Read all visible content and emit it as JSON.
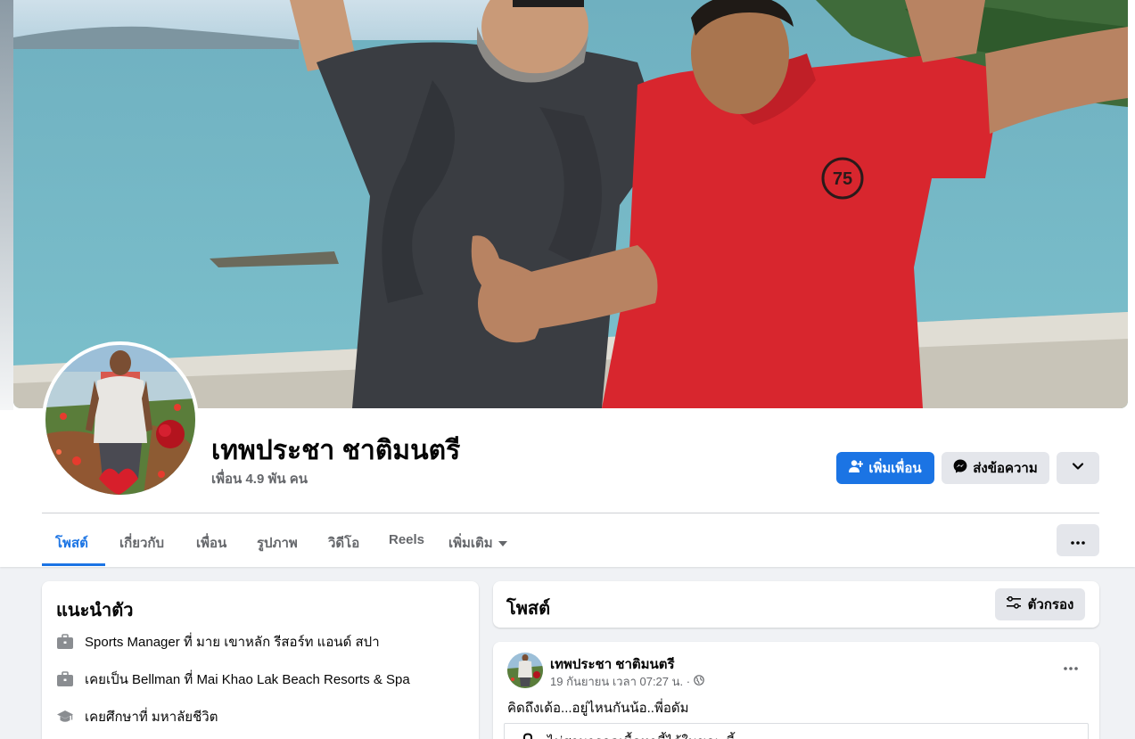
{
  "profile": {
    "name": "เทพประชา ชาติมนตรี",
    "friends": "เพื่อน 4.9 พัน คน"
  },
  "actions": {
    "add_friend": "เพิ่มเพื่อน",
    "message": "ส่งข้อความ"
  },
  "tabs": [
    {
      "label": "โพสต์",
      "active": true
    },
    {
      "label": "เกี่ยวกับ"
    },
    {
      "label": "เพื่อน"
    },
    {
      "label": "รูปภาพ"
    },
    {
      "label": "วิดีโอ"
    },
    {
      "label": "Reels"
    },
    {
      "label": "เพิ่มเติม"
    }
  ],
  "intro": {
    "title": "แนะนำตัว",
    "items": [
      {
        "icon": "briefcase-icon",
        "text": "Sports Manager ที่ มาย เขาหลัก รีสอร์ท แอนด์ สปา"
      },
      {
        "icon": "briefcase-icon",
        "prefix": "เคยเป็น Bellman ที่ ",
        "bold": "Mai Khao Lak Beach Resorts & Spa"
      },
      {
        "icon": "graduation-cap-icon",
        "text": "เคยศึกษาที่ มหาลัยชีวิต"
      }
    ]
  },
  "posts": {
    "title": "โพสต์",
    "filter": "ตัวกรอง",
    "items": [
      {
        "author": "เทพประชา ชาติมนตรี",
        "date": "19 กันยายน เวลา 07:27 น. ·",
        "text": "คิดถึงเด้อ...อยู่ไหนกันน้อ..พี่อดัม",
        "embed": "ไม่สามารถดูเนื้อหานี้ได้ในขณะนี้"
      }
    ]
  },
  "colors": {
    "accent": "#1b74e4",
    "secondary_button": "#e4e6eb",
    "muted_text": "#65676b",
    "background": "#f0f2f5"
  }
}
